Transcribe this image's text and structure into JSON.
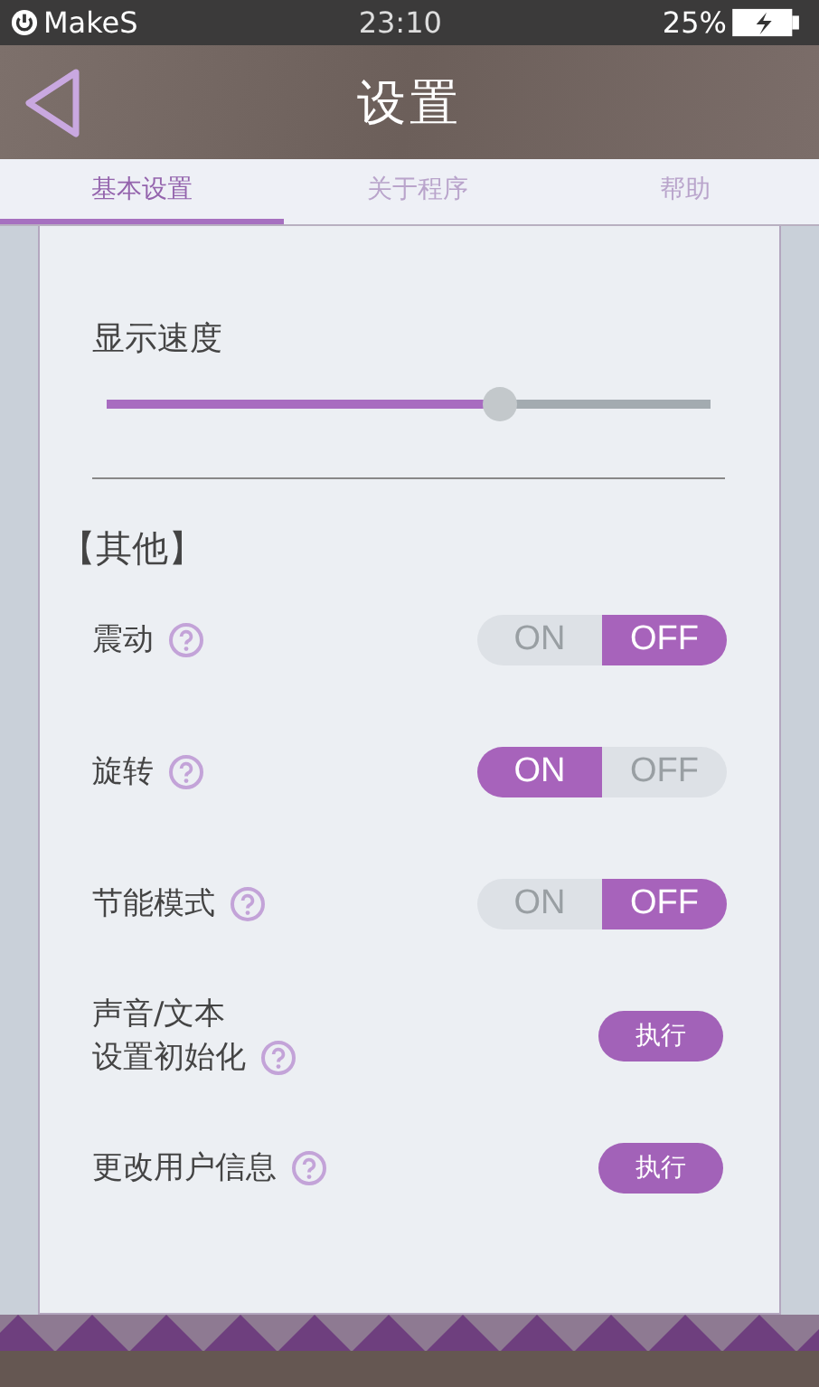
{
  "status_bar": {
    "carrier": "MakeS",
    "time": "23:10",
    "battery": "25%"
  },
  "header": {
    "title": "设置"
  },
  "tabs": [
    {
      "label": "基本设置",
      "selected": true
    },
    {
      "label": "关于程序",
      "selected": false
    },
    {
      "label": "帮助",
      "selected": false
    }
  ],
  "speed": {
    "label": "显示速度",
    "level": 0.66
  },
  "section": {
    "title": "【其他】"
  },
  "settings": [
    {
      "kind": "toggle",
      "label_lines": [
        "震动"
      ],
      "on": false,
      "on_label": "ON",
      "off_label": "OFF"
    },
    {
      "kind": "toggle",
      "label_lines": [
        "旋转"
      ],
      "on": true,
      "on_label": "ON",
      "off_label": "OFF"
    },
    {
      "kind": "toggle",
      "label_lines": [
        "节能模式"
      ],
      "on": false,
      "on_label": "ON",
      "off_label": "OFF"
    },
    {
      "kind": "action",
      "label_lines": [
        "声音/文本",
        "设置初始化"
      ],
      "button": "执行"
    },
    {
      "kind": "action",
      "label_lines": [
        "更改用户信息"
      ],
      "button": "执行"
    }
  ]
}
